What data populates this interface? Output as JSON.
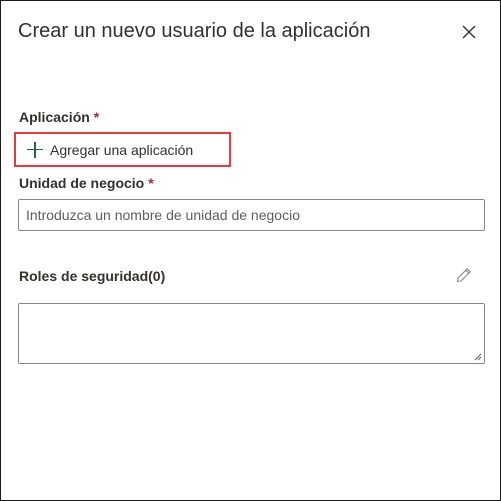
{
  "dialog": {
    "title": "Crear un nuevo usuario de la aplicación",
    "close_icon": "close-icon"
  },
  "application": {
    "label": "Aplicación",
    "required_marker": "*",
    "add_button_label": "Agregar una aplicación",
    "add_icon": "plus-icon",
    "highlight_color": "#e8393d"
  },
  "business_unit": {
    "label": "Unidad de negocio",
    "required_marker": "*",
    "value": "",
    "placeholder": "Introduzca un nombre de unidad de negocio"
  },
  "security_roles": {
    "label": "Roles de seguridad(0)",
    "edit_icon": "pencil-icon",
    "value": ""
  },
  "colors": {
    "required": "#a4262c",
    "text": "#323130",
    "border": "#8a8886"
  }
}
